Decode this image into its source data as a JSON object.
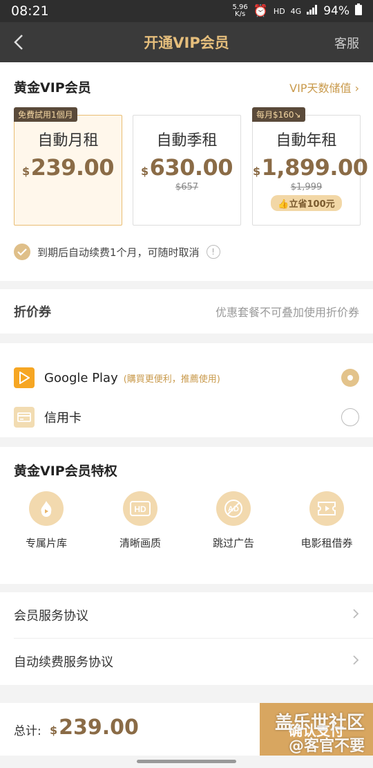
{
  "status": {
    "time": "08:21",
    "speed_top": "5.96",
    "speed_bottom": "K/s",
    "hd": "HD",
    "net": "4G",
    "battery": "94%"
  },
  "nav": {
    "title": "开通VIP会员",
    "service": "客服"
  },
  "membership": {
    "title": "黄金VIP会员",
    "link": "VIP天数储值",
    "plans": [
      {
        "tag": "免費試用1個月",
        "name": "自動月租",
        "currency": "$",
        "price": "239.00",
        "original": "",
        "save": ""
      },
      {
        "tag": "",
        "name": "自動季租",
        "currency": "$",
        "price": "630.00",
        "original": "$657",
        "save": ""
      },
      {
        "tag": "每月$160↘",
        "name": "自動年租",
        "currency": "$",
        "price": "1,899.00",
        "original": "$1,999",
        "save": "立省100元"
      }
    ],
    "autorenew": "到期后自动续费1个月，可随时取消"
  },
  "coupon": {
    "label": "折价券",
    "hint": "优惠套餐不可叠加使用折价券"
  },
  "payment": {
    "methods": [
      {
        "name": "Google Play",
        "note": "(購買更便利，推薦使用)",
        "selected": true,
        "icon": "google-play-icon"
      },
      {
        "name": "信用卡",
        "note": "",
        "selected": false,
        "icon": "credit-card-icon"
      }
    ]
  },
  "perks": {
    "title": "黄金VIP会员特权",
    "items": [
      {
        "label": "专属片库",
        "icon": "exclusive-library-icon"
      },
      {
        "label": "清晰画质",
        "icon": "hd-icon"
      },
      {
        "label": "跳过广告",
        "icon": "skip-ad-icon"
      },
      {
        "label": "电影租借券",
        "icon": "movie-ticket-icon"
      }
    ]
  },
  "agreements": [
    "会员服务协议",
    "自动续费服务协议"
  ],
  "footer": {
    "total_label": "总计:",
    "currency": "$",
    "total": "239.00",
    "pay_button": "确认支付"
  },
  "watermark": {
    "line1": "盖乐世社区",
    "line2": "@客官不要"
  },
  "colors": {
    "gold": "#c99a4c",
    "price": "#8a6b46",
    "nav_bg": "#3a3a3a",
    "button": "#d8a660"
  }
}
